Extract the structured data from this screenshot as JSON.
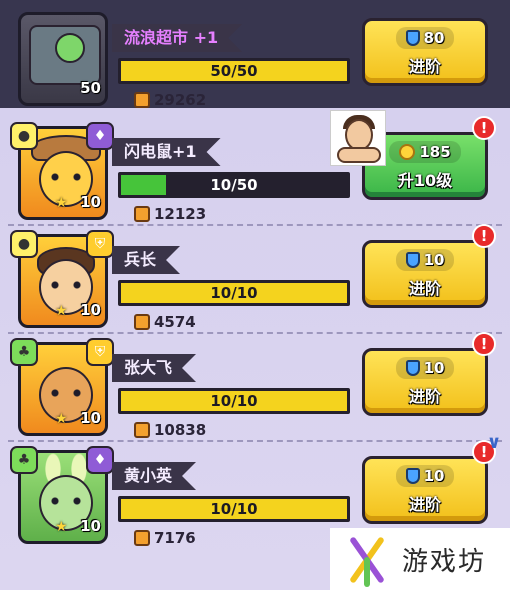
{
  "rows": [
    {
      "name": "流浪超市",
      "name_suffix": "+1",
      "level": "50",
      "progress_text": "50/50",
      "progress_fraction": 1.0,
      "power": "29262",
      "cost": "80",
      "cost_icon": "shield-icon",
      "action_label": "进阶",
      "action_style": "yellow",
      "alert": false
    },
    {
      "name": "闪电鼠",
      "name_suffix": "+1",
      "level": "10",
      "progress_text": "10/50",
      "progress_fraction": 0.2,
      "power": "12123",
      "cost": "185",
      "cost_icon": "coin-icon",
      "action_label": "升10级",
      "action_style": "green",
      "alert": true,
      "alert_mark": "!"
    },
    {
      "name": "兵长",
      "level": "10",
      "progress_text": "10/10",
      "progress_fraction": 1.0,
      "power": "4574",
      "cost": "10",
      "cost_icon": "shield-icon",
      "action_label": "进阶",
      "action_style": "yellow",
      "alert": true,
      "alert_mark": "!"
    },
    {
      "name": "张大飞",
      "level": "10",
      "progress_text": "10/10",
      "progress_fraction": 1.0,
      "power": "10838",
      "cost": "10",
      "cost_icon": "shield-icon",
      "action_label": "进阶",
      "action_style": "yellow",
      "alert": true,
      "alert_mark": "!"
    },
    {
      "name": "黄小英",
      "level": "10",
      "progress_text": "10/10",
      "progress_fraction": 1.0,
      "power": "7176",
      "cost": "10",
      "cost_icon": "shield-icon",
      "action_label": "进阶",
      "action_style": "yellow",
      "alert": true,
      "alert_mark": "!"
    }
  ],
  "watermark": {
    "text": "游戏坊"
  },
  "colors": {
    "header_bg": "#38364f",
    "list_bg": "#d8d2ec",
    "bar_yellow": "#f4d31e",
    "bar_green": "#46c43a",
    "button_yellow": "#f2c01a",
    "button_green": "#3ab548",
    "alert_red": "#e82a2a",
    "name_highlight": "#e680ff"
  }
}
